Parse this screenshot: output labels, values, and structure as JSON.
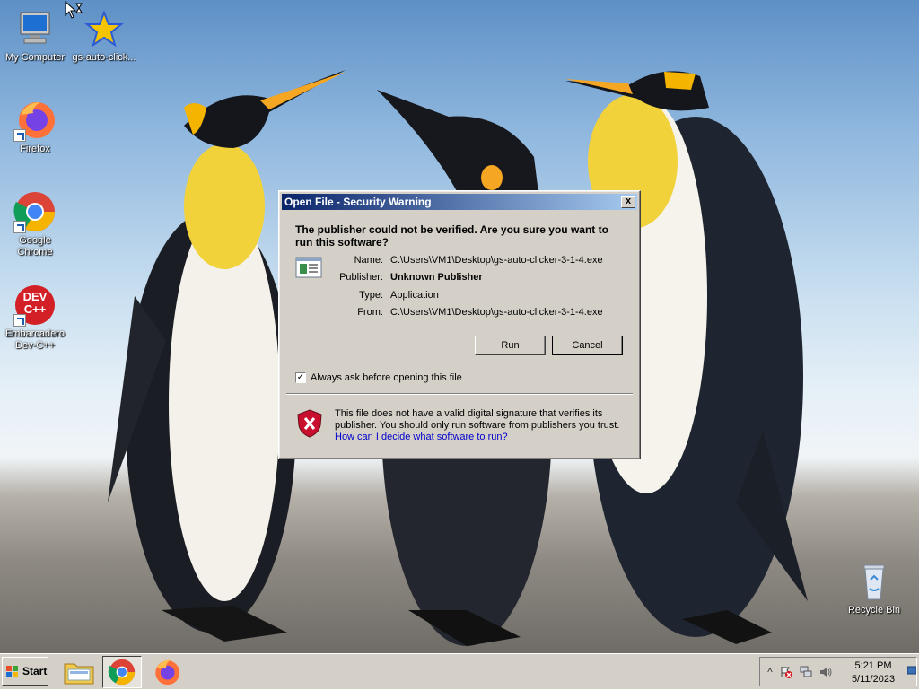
{
  "desktop": {
    "icons": [
      {
        "label": "My Computer",
        "icon": "computer-icon"
      },
      {
        "label": "gs-auto-click...",
        "icon": "star-icon"
      },
      {
        "label": "Firefox",
        "icon": "firefox-icon"
      },
      {
        "label": "Google Chrome",
        "icon": "chrome-icon"
      },
      {
        "label": "Embarcadero Dev-C++",
        "icon": "devcpp-icon",
        "art_text": "DEV C++"
      },
      {
        "label": "Recycle Bin",
        "icon": "recycle-bin-icon"
      }
    ]
  },
  "dialog": {
    "title": "Open File - Security Warning",
    "close_label": "x",
    "heading": "The publisher could not be verified.  Are you sure you want to run this software?",
    "fields": [
      {
        "label": "Name:",
        "value": "C:\\Users\\VM1\\Desktop\\gs-auto-clicker-3-1-4.exe"
      },
      {
        "label": "Publisher:",
        "value": "Unknown Publisher"
      },
      {
        "label": "Type:",
        "value": "Application"
      },
      {
        "label": "From:",
        "value": "C:\\Users\\VM1\\Desktop\\gs-auto-clicker-3-1-4.exe"
      }
    ],
    "run_label": "Run",
    "cancel_label": "Cancel",
    "checkbox_label": "Always ask before opening this file",
    "checkbox_mark": "✓",
    "checkbox_checked": true,
    "warning_text": "This file does not have a valid digital signature that verifies its publisher.  You should only run software from publishers you trust.",
    "help_link": "How can I decide what software to run?"
  },
  "taskbar": {
    "start_label": "Start",
    "apps": [
      {
        "name": "File Explorer",
        "icon": "folder-icon"
      },
      {
        "name": "Google Chrome",
        "icon": "chrome-icon",
        "active": true
      },
      {
        "name": "Firefox",
        "icon": "firefox-icon"
      }
    ],
    "tray": {
      "expand_label": "^",
      "time": "5:21 PM",
      "date": "5/11/2023"
    }
  },
  "colors": {
    "title_bar_start": "#0a246a",
    "title_bar_end": "#a6caf0",
    "dialog_face": "#d4d0c8",
    "link": "#0000cc",
    "shield_red": "#c8102e"
  }
}
